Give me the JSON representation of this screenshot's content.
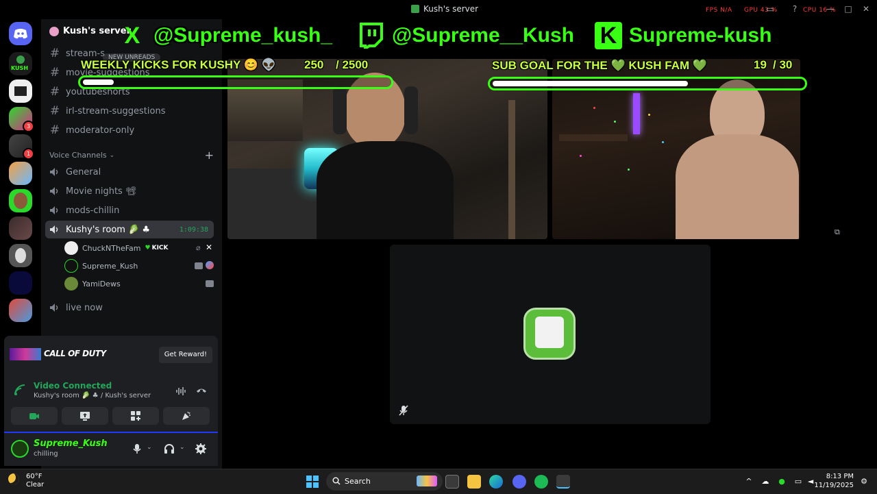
{
  "window": {
    "title": "Kush's server",
    "perf": {
      "fps_label": "FPS",
      "fps_value": "N/A",
      "gpu_label": "GPU",
      "gpu_value": "43 %",
      "cpu_label": "CPU",
      "cpu_value": "16 %"
    }
  },
  "rail": {
    "badges": [
      "3",
      "1"
    ],
    "kush_label": "KUSH"
  },
  "sidebar": {
    "server_name": "Kush's server",
    "new_unreads": "NEW UNREADS",
    "text_channels": [
      {
        "name": "stream-s"
      },
      {
        "name": "movie-suggestions"
      },
      {
        "name": "youtubeshorts"
      },
      {
        "name": "irl-stream-suggestions"
      },
      {
        "name": "moderator-only"
      }
    ],
    "voice_header": "Voice Channels",
    "voice_channels": [
      {
        "name": "General"
      },
      {
        "name": "Movie nights 📽"
      },
      {
        "name": "mods-chillin"
      },
      {
        "name": "Kushy's room 🥬 ♣",
        "time": "1:09:38"
      },
      {
        "name": "live now"
      }
    ],
    "members": [
      {
        "name": "ChuckNTheFam",
        "badge": "KICK"
      },
      {
        "name": "Supreme_Kush"
      },
      {
        "name": "YamiDews"
      }
    ]
  },
  "promo": {
    "logo": "CALL OF DUTY",
    "button": "Get Reward!"
  },
  "voice_connection": {
    "status": "Video Connected",
    "location": "Kushy's room 🥬 ♣ / Kush's server"
  },
  "user": {
    "name": "Supreme_Kush",
    "status": "chilling"
  },
  "overlay": {
    "socials": [
      {
        "icon": "x-icon",
        "glyph": "X",
        "handle": "@Supreme_kush_"
      },
      {
        "icon": "twitch-icon",
        "glyph": "⌂",
        "handle": "@Supreme__Kush"
      },
      {
        "icon": "kick-icon",
        "glyph": "K",
        "handle": "Supreme-kush"
      }
    ],
    "kicks_goal": {
      "label": "WEEKLY KICKS FOR KUSHY 😊 👽",
      "current": "250",
      "target": "/ 2500",
      "progress": 0.1
    },
    "sub_goal": {
      "label": "SUB GOAL FOR THE 💚 KUSH FAM 💚",
      "current": "19",
      "target": "/ 30",
      "progress": 0.63
    }
  },
  "taskbar": {
    "weather_temp": "60°F",
    "weather_desc": "Clear",
    "search_placeholder": "Search",
    "time": "8:13 PM",
    "date": "11/19/2025"
  },
  "colors": {
    "accent_green": "#39ff14",
    "discord_bg": "#111214",
    "connected_green": "#23a55a",
    "badge_red": "#f23f43"
  }
}
